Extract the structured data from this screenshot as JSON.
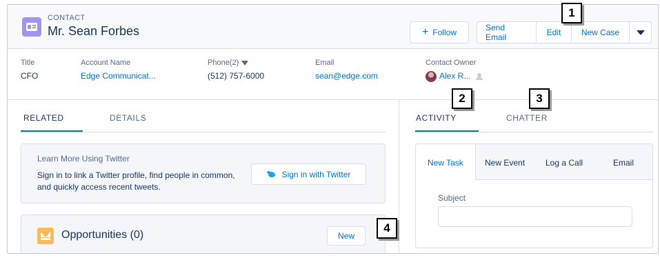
{
  "header": {
    "object_label": "CONTACT",
    "record_name": "Mr. Sean Forbes",
    "follow_label": "Follow",
    "actions": [
      "Send Email",
      "Edit",
      "New Case"
    ]
  },
  "highlights": [
    {
      "label": "Title",
      "value": "CFO"
    },
    {
      "label": "Account Name",
      "value": "Edge Communicat..."
    },
    {
      "label": "Phone(2)",
      "value": "(512) 757-6000"
    },
    {
      "label": "Email",
      "value": "sean@edge.com"
    },
    {
      "label": "Contact Owner",
      "value": "Alex R..."
    }
  ],
  "left_tabs": [
    "RELATED",
    "DETAILS"
  ],
  "twitter": {
    "title": "Learn More Using Twitter",
    "text": "Sign in to link a Twitter profile, find people in common, and quickly access recent tweets.",
    "button": "Sign in with Twitter"
  },
  "opportunities": {
    "title": "Opportunities (0)",
    "new_label": "New"
  },
  "right_tabs": [
    "ACTIVITY",
    "CHATTER"
  ],
  "composer": {
    "tabs": [
      "New Task",
      "New Event",
      "Log a Call",
      "Email"
    ],
    "subject_label": "Subject",
    "subject_value": ""
  },
  "callouts": [
    "1",
    "2",
    "3",
    "4"
  ],
  "colors": {
    "brand": "#0070d2",
    "contact_icon": "#a094ed",
    "opportunity_icon": "#fcb95b",
    "text": "#16325c",
    "muted": "#54698d"
  }
}
